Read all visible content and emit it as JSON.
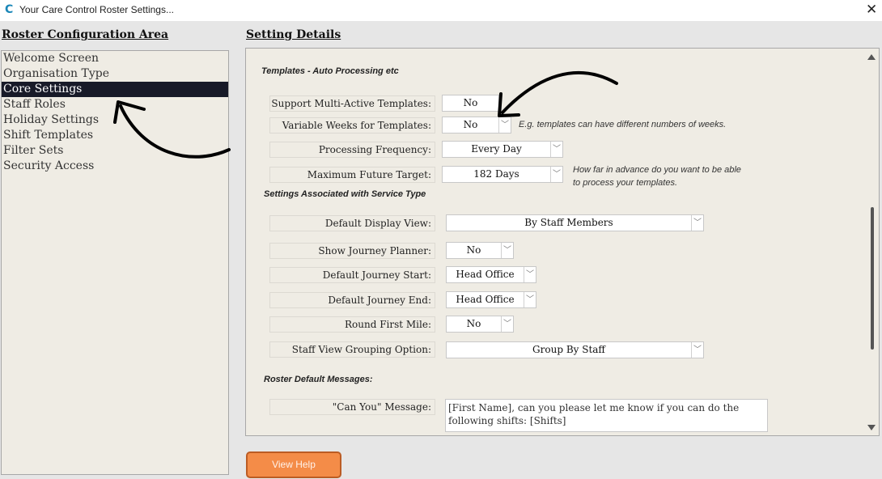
{
  "window": {
    "title": "Your Care Control Roster Settings...",
    "app_icon": "care-control-c-icon",
    "close_glyph": "✕"
  },
  "left_panel": {
    "heading": "Roster Configuration Area",
    "items": [
      {
        "label": "Welcome Screen",
        "selected": false
      },
      {
        "label": "Organisation Type",
        "selected": false
      },
      {
        "label": "Core Settings",
        "selected": true
      },
      {
        "label": "Staff Roles",
        "selected": false
      },
      {
        "label": "Holiday Settings",
        "selected": false
      },
      {
        "label": "Shift Templates",
        "selected": false
      },
      {
        "label": "Filter Sets",
        "selected": false
      },
      {
        "label": "Security Access",
        "selected": false
      }
    ]
  },
  "details": {
    "heading": "Setting Details",
    "templates": {
      "title": "Templates - Auto Processing etc",
      "support_multi_active": {
        "label": "Support Multi-Active Templates:",
        "value": "No"
      },
      "variable_weeks": {
        "label": "Variable Weeks for Templates:",
        "value": "No",
        "note": "E.g. templates can have different numbers of weeks."
      },
      "processing_frequency": {
        "label": "Processing Frequency:",
        "value": "Every Day"
      },
      "max_future_target": {
        "label": "Maximum Future Target:",
        "value": "182 Days",
        "note_line1": "How far in advance do you want to be able",
        "note_line2": "to process your templates."
      }
    },
    "service_type": {
      "title": "Settings Associated with Service Type",
      "default_display_view": {
        "label": "Default Display View:",
        "value": "By Staff Members"
      },
      "show_journey_planner": {
        "label": "Show Journey Planner:",
        "value": "No"
      },
      "default_journey_start": {
        "label": "Default Journey Start:",
        "value": "Head Office"
      },
      "default_journey_end": {
        "label": "Default Journey End:",
        "value": "Head Office"
      },
      "round_first_mile": {
        "label": "Round First Mile:",
        "value": "No"
      },
      "staff_view_grouping": {
        "label": "Staff View Grouping Option:",
        "value": "Group By Staff"
      }
    },
    "messages": {
      "title": "Roster Default Messages:",
      "can_you": {
        "label": "\"Can You\" Message:",
        "value": "[First Name], can you please let me know if you can do the following shifts: [Shifts]"
      }
    }
  },
  "footer": {
    "view_help_label": "View Help"
  },
  "colors": {
    "panel_bg": "#efece4",
    "selected_bg": "#181a28",
    "help_button": "#f48c48",
    "help_border": "#bb5c24"
  },
  "icons": {
    "dropdown": "chevron-down-icon",
    "scroll_up": "scroll-up-arrow-icon",
    "scroll_down": "scroll-down-arrow-icon",
    "annotation": "hand-drawn-arrow-icon"
  }
}
